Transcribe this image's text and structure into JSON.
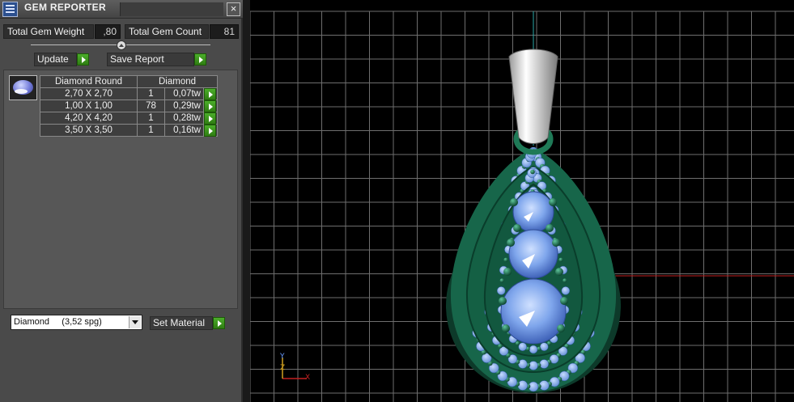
{
  "window": {
    "title": "GEM REPORTER",
    "close_icon": "close-icon"
  },
  "stats": {
    "total_weight_label": "Total Gem Weight",
    "total_weight_value": ",80",
    "total_count_label": "Total Gem Count",
    "total_count_value": "81"
  },
  "buttons": {
    "update": "Update",
    "save_report": "Save Report",
    "set_material": "Set Material"
  },
  "table": {
    "headers": [
      "Diamond Round",
      "Diamond"
    ],
    "rows": [
      {
        "size": "2,70 X 2,70",
        "count": "1",
        "weight": "0,07tw"
      },
      {
        "size": "1,00 X 1,00",
        "count": "78",
        "weight": "0,29tw"
      },
      {
        "size": "4,20 X 4,20",
        "count": "1",
        "weight": "0,28tw"
      },
      {
        "size": "3,50 X 3,50",
        "count": "1",
        "weight": "0,16tw"
      }
    ]
  },
  "material": {
    "selected": "Diamond     (3,52 spg)"
  },
  "viewport": {
    "axis_labels": {
      "y": "Y",
      "z": "Z",
      "x": "X"
    }
  },
  "colors": {
    "metal": "#1b6b4e",
    "gem": "#8fb4f2",
    "bail": "#e8e8e8",
    "grid": "#6e6e6e",
    "x_axis": "#c22020",
    "y_axis": "#2aa8a8"
  }
}
